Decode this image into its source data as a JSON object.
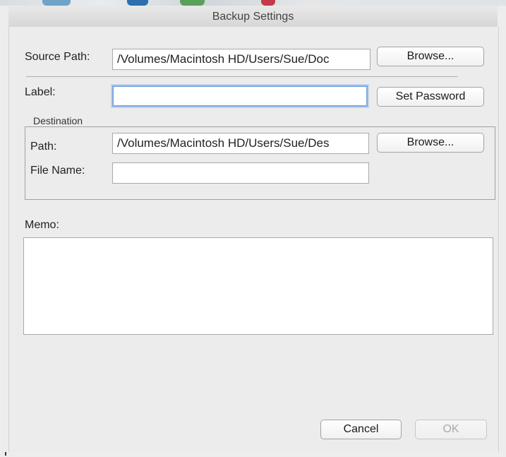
{
  "window": {
    "title": "Backup Settings"
  },
  "source": {
    "label": "Source Path:",
    "value": "/Volumes/Macintosh HD/Users/Sue/Doc",
    "browse_label": "Browse..."
  },
  "label_row": {
    "label": "Label:",
    "value": "",
    "set_password_label": "Set Password"
  },
  "destination": {
    "group_label": "Destination",
    "path_label": "Path:",
    "path_value": "/Volumes/Macintosh HD/Users/Sue/Des",
    "browse_label": "Browse...",
    "file_name_label": "File Name:",
    "file_name_value": ""
  },
  "memo": {
    "label": "Memo:",
    "value": ""
  },
  "footer": {
    "cancel_label": "Cancel",
    "ok_label": "OK"
  },
  "colors": {
    "focus_ring": "#7aa7e0",
    "window_bg": "#ececec"
  }
}
